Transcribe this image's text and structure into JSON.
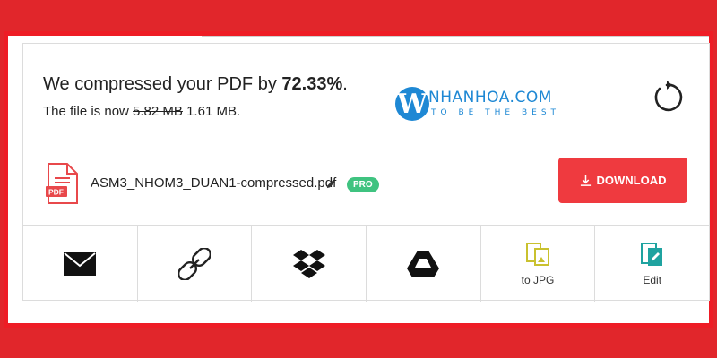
{
  "result": {
    "title_prefix": "We compressed your PDF by ",
    "percent": "72.33%",
    "title_suffix": ".",
    "sub_prefix": "The file is now ",
    "old_size": "5.82 MB",
    "new_size": "1.61 MB",
    "sub_suffix": "."
  },
  "logo": {
    "letter": "W",
    "name": "NHANHOA.COM",
    "tagline": "TO BE THE BEST",
    "color": "#1e88d4"
  },
  "restart": {
    "icon": "restart-icon"
  },
  "file": {
    "icon": "pdf-file-icon",
    "icon_text": "PDF",
    "name": "ASM3_NHOM3_DUAN1-compressed.pdf",
    "badge": "PRO",
    "badge_color": "#3fc380"
  },
  "download": {
    "label": "DOWNLOAD",
    "color": "#ef3a3f"
  },
  "actions": [
    {
      "icon": "email-icon",
      "label": ""
    },
    {
      "icon": "link-icon",
      "label": ""
    },
    {
      "icon": "dropbox-icon",
      "label": ""
    },
    {
      "icon": "google-drive-icon",
      "label": ""
    },
    {
      "icon": "to-jpg-icon",
      "label": "to JPG"
    },
    {
      "icon": "edit-pdf-icon",
      "label": "Edit"
    }
  ],
  "colors": {
    "background": "#e1262b",
    "frame": "#ee1c25"
  }
}
